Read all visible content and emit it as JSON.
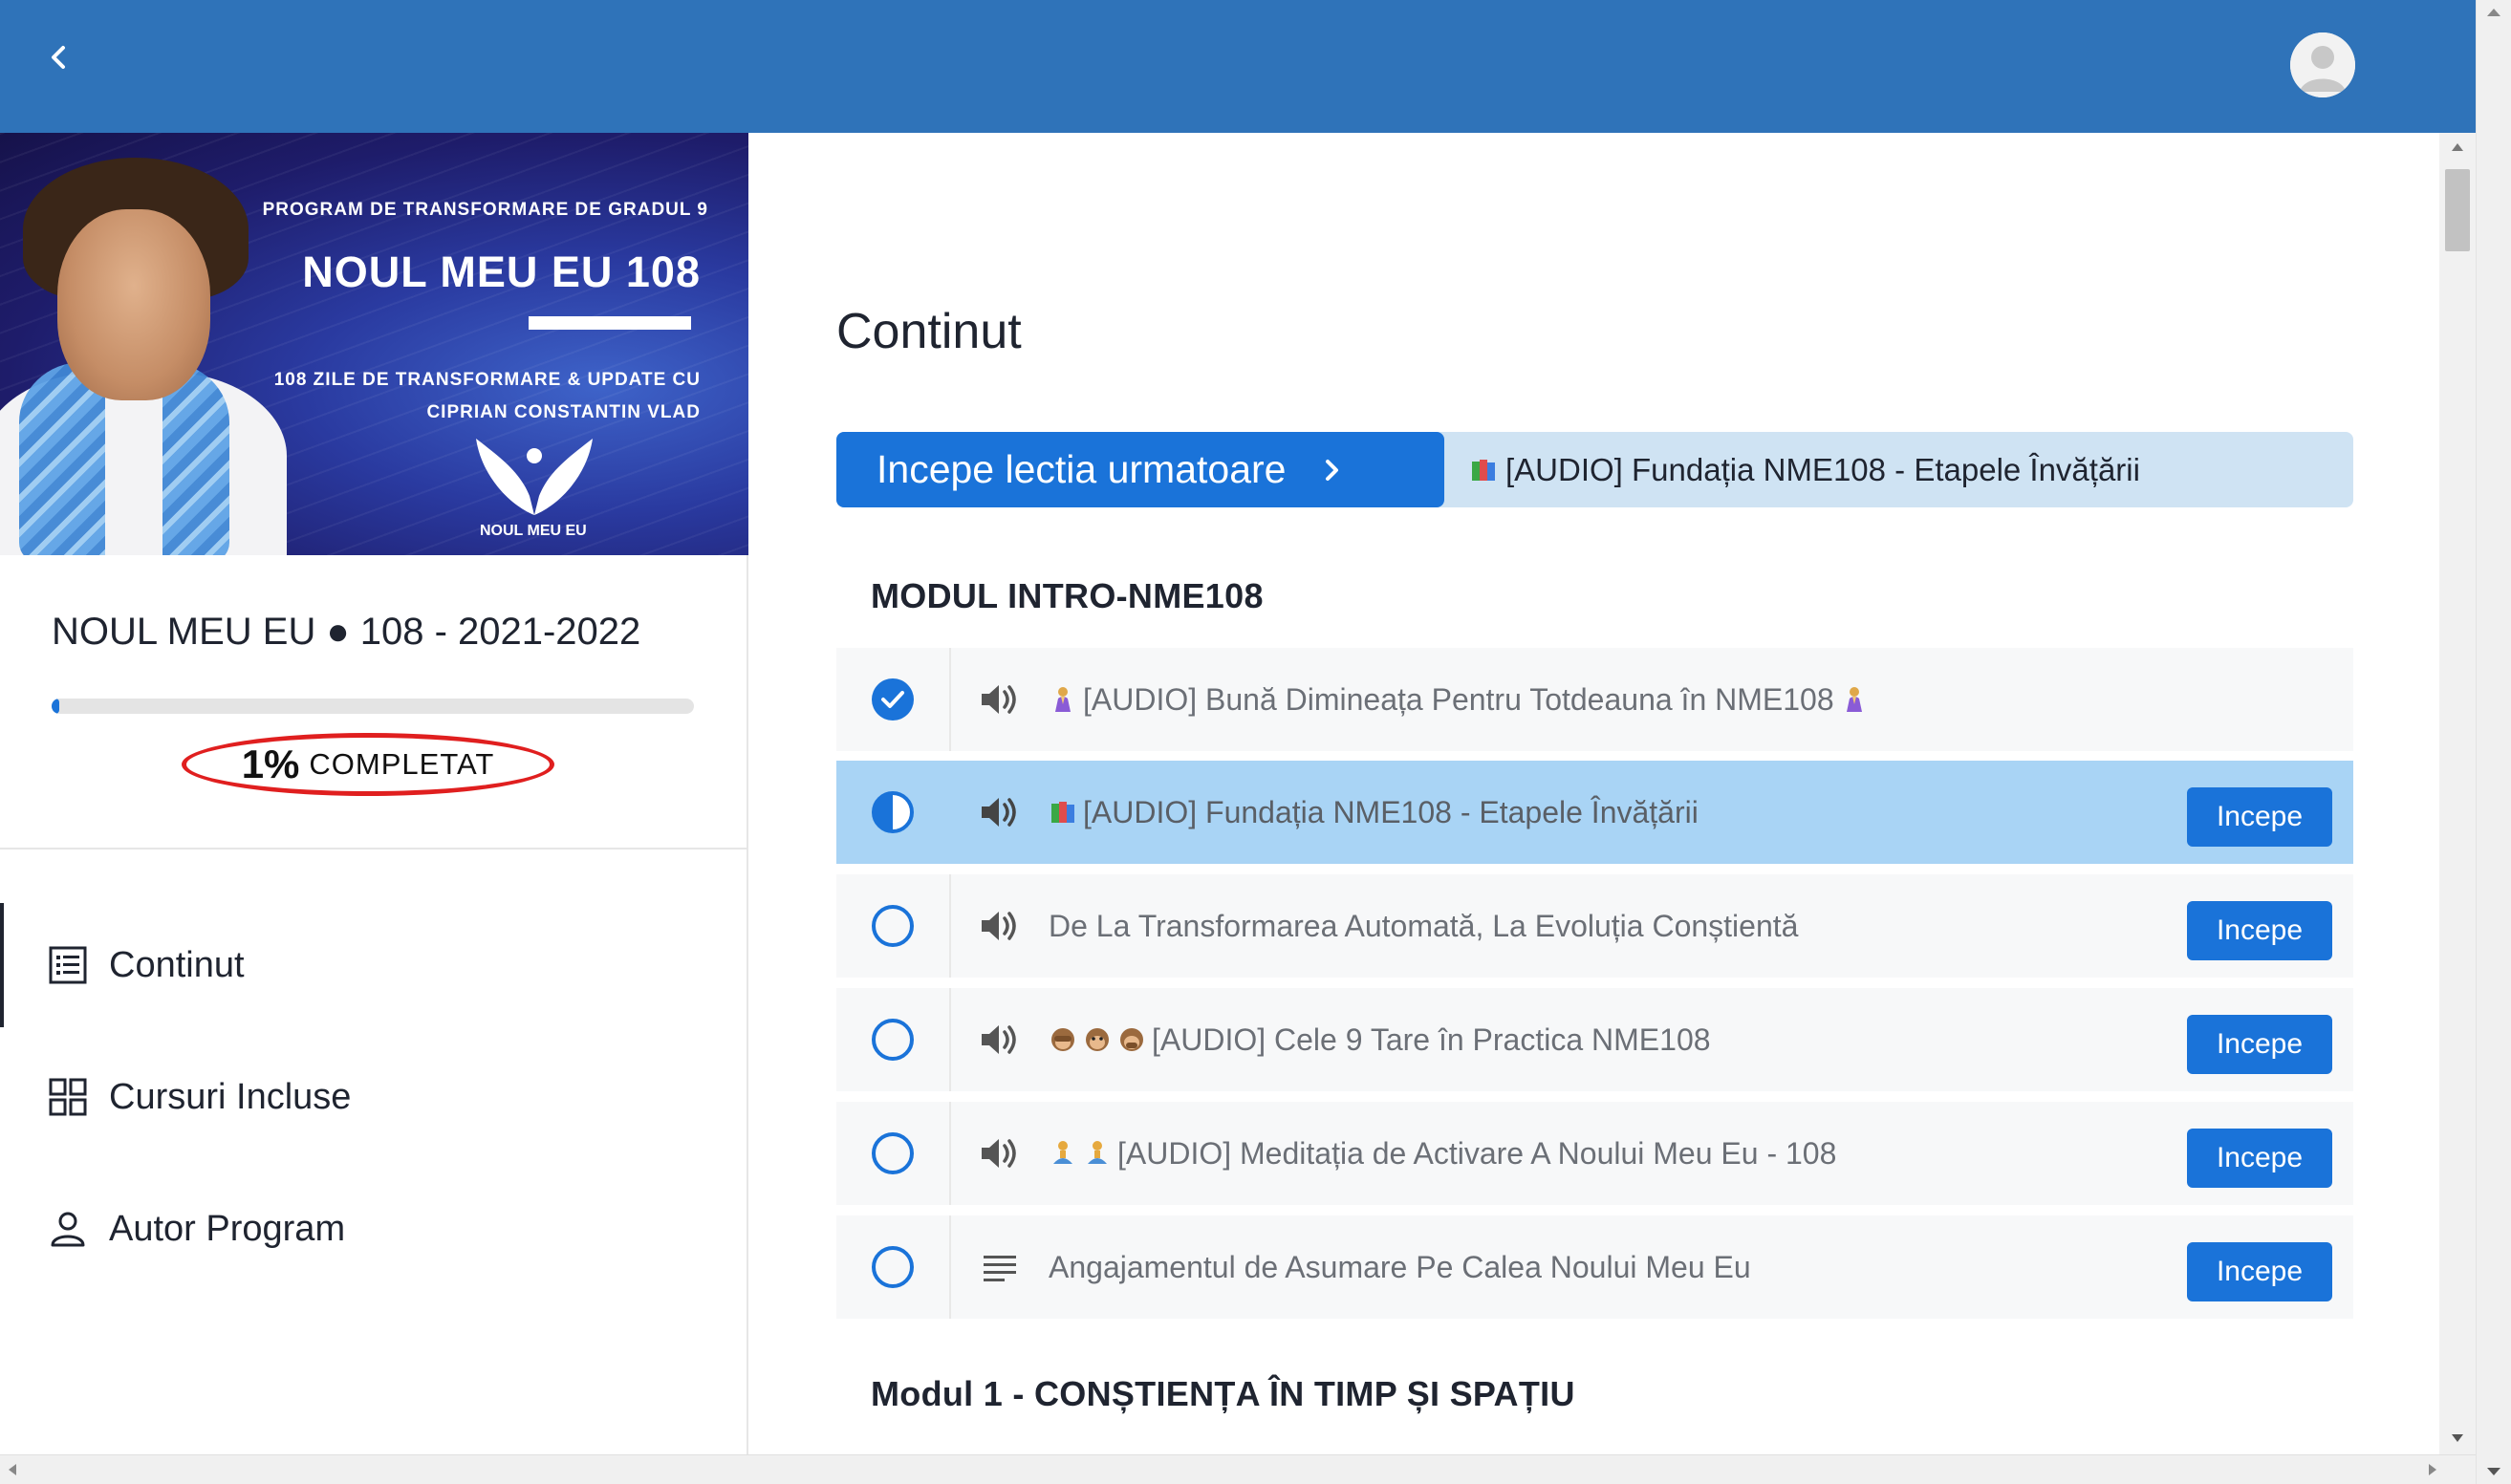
{
  "header": {
    "back_icon": "chevron-left-icon",
    "avatar_icon": "user-avatar-icon"
  },
  "banner": {
    "line1": "PROGRAM DE TRANSFORMARE DE GRADUL 9",
    "line2": "NOUL MEU EU 108",
    "line3a": "108 ZILE DE TRANSFORMARE & UPDATE CU",
    "line3b": "CIPRIAN CONSTANTIN VLAD",
    "logo_text": "NOUL MEU EU"
  },
  "course": {
    "title": "NOUL MEU EU ● 108 - 2021-2022",
    "progress_fraction": 0.01,
    "progress_pct": "1%",
    "progress_label": "COMPLETAT"
  },
  "nav": {
    "items": [
      {
        "label": "Continut",
        "icon": "list-icon",
        "active": true
      },
      {
        "label": "Cursuri Incluse",
        "icon": "grid-icon",
        "active": false
      },
      {
        "label": "Autor Program",
        "icon": "person-icon",
        "active": false
      }
    ]
  },
  "main": {
    "title": "Continut",
    "next_button_label": "Incepe lectia urmatoare",
    "next_lesson_title": "[AUDIO] Fundația NME108 - Etapele Învățării",
    "modules": [
      {
        "title": "MODUL INTRO-NME108"
      },
      {
        "title": "Modul 1 - CONȘTIENȚA ÎN TIMP ȘI SPAȚIU"
      }
    ],
    "begin_label": "Incepe",
    "lessons": [
      {
        "title": "[AUDIO] Bună Dimineața Pentru Totdeauna în NME108",
        "status": "done",
        "type": "audio"
      },
      {
        "title": "[AUDIO] Fundația NME108 - Etapele Învățării",
        "status": "in-progress",
        "type": "audio"
      },
      {
        "title": "De La Transformarea Automată, La Evoluția Conștientă",
        "status": "todo",
        "type": "audio"
      },
      {
        "title": "[AUDIO] Cele 9 Tare în Practica NME108",
        "status": "todo",
        "type": "audio"
      },
      {
        "title": "[AUDIO] Meditația de Activare A Noului Meu Eu - 108",
        "status": "todo",
        "type": "audio"
      },
      {
        "title": "Angajamentul de Asumare Pe Calea Noului Meu Eu",
        "status": "todo",
        "type": "text"
      }
    ]
  },
  "colors": {
    "topbar": "#2f73b9",
    "primary": "#1a73d9",
    "current_row": "#a9d4f5",
    "next_bar": "#cfe3f3",
    "highlight_ellipse": "#e01f1f"
  }
}
